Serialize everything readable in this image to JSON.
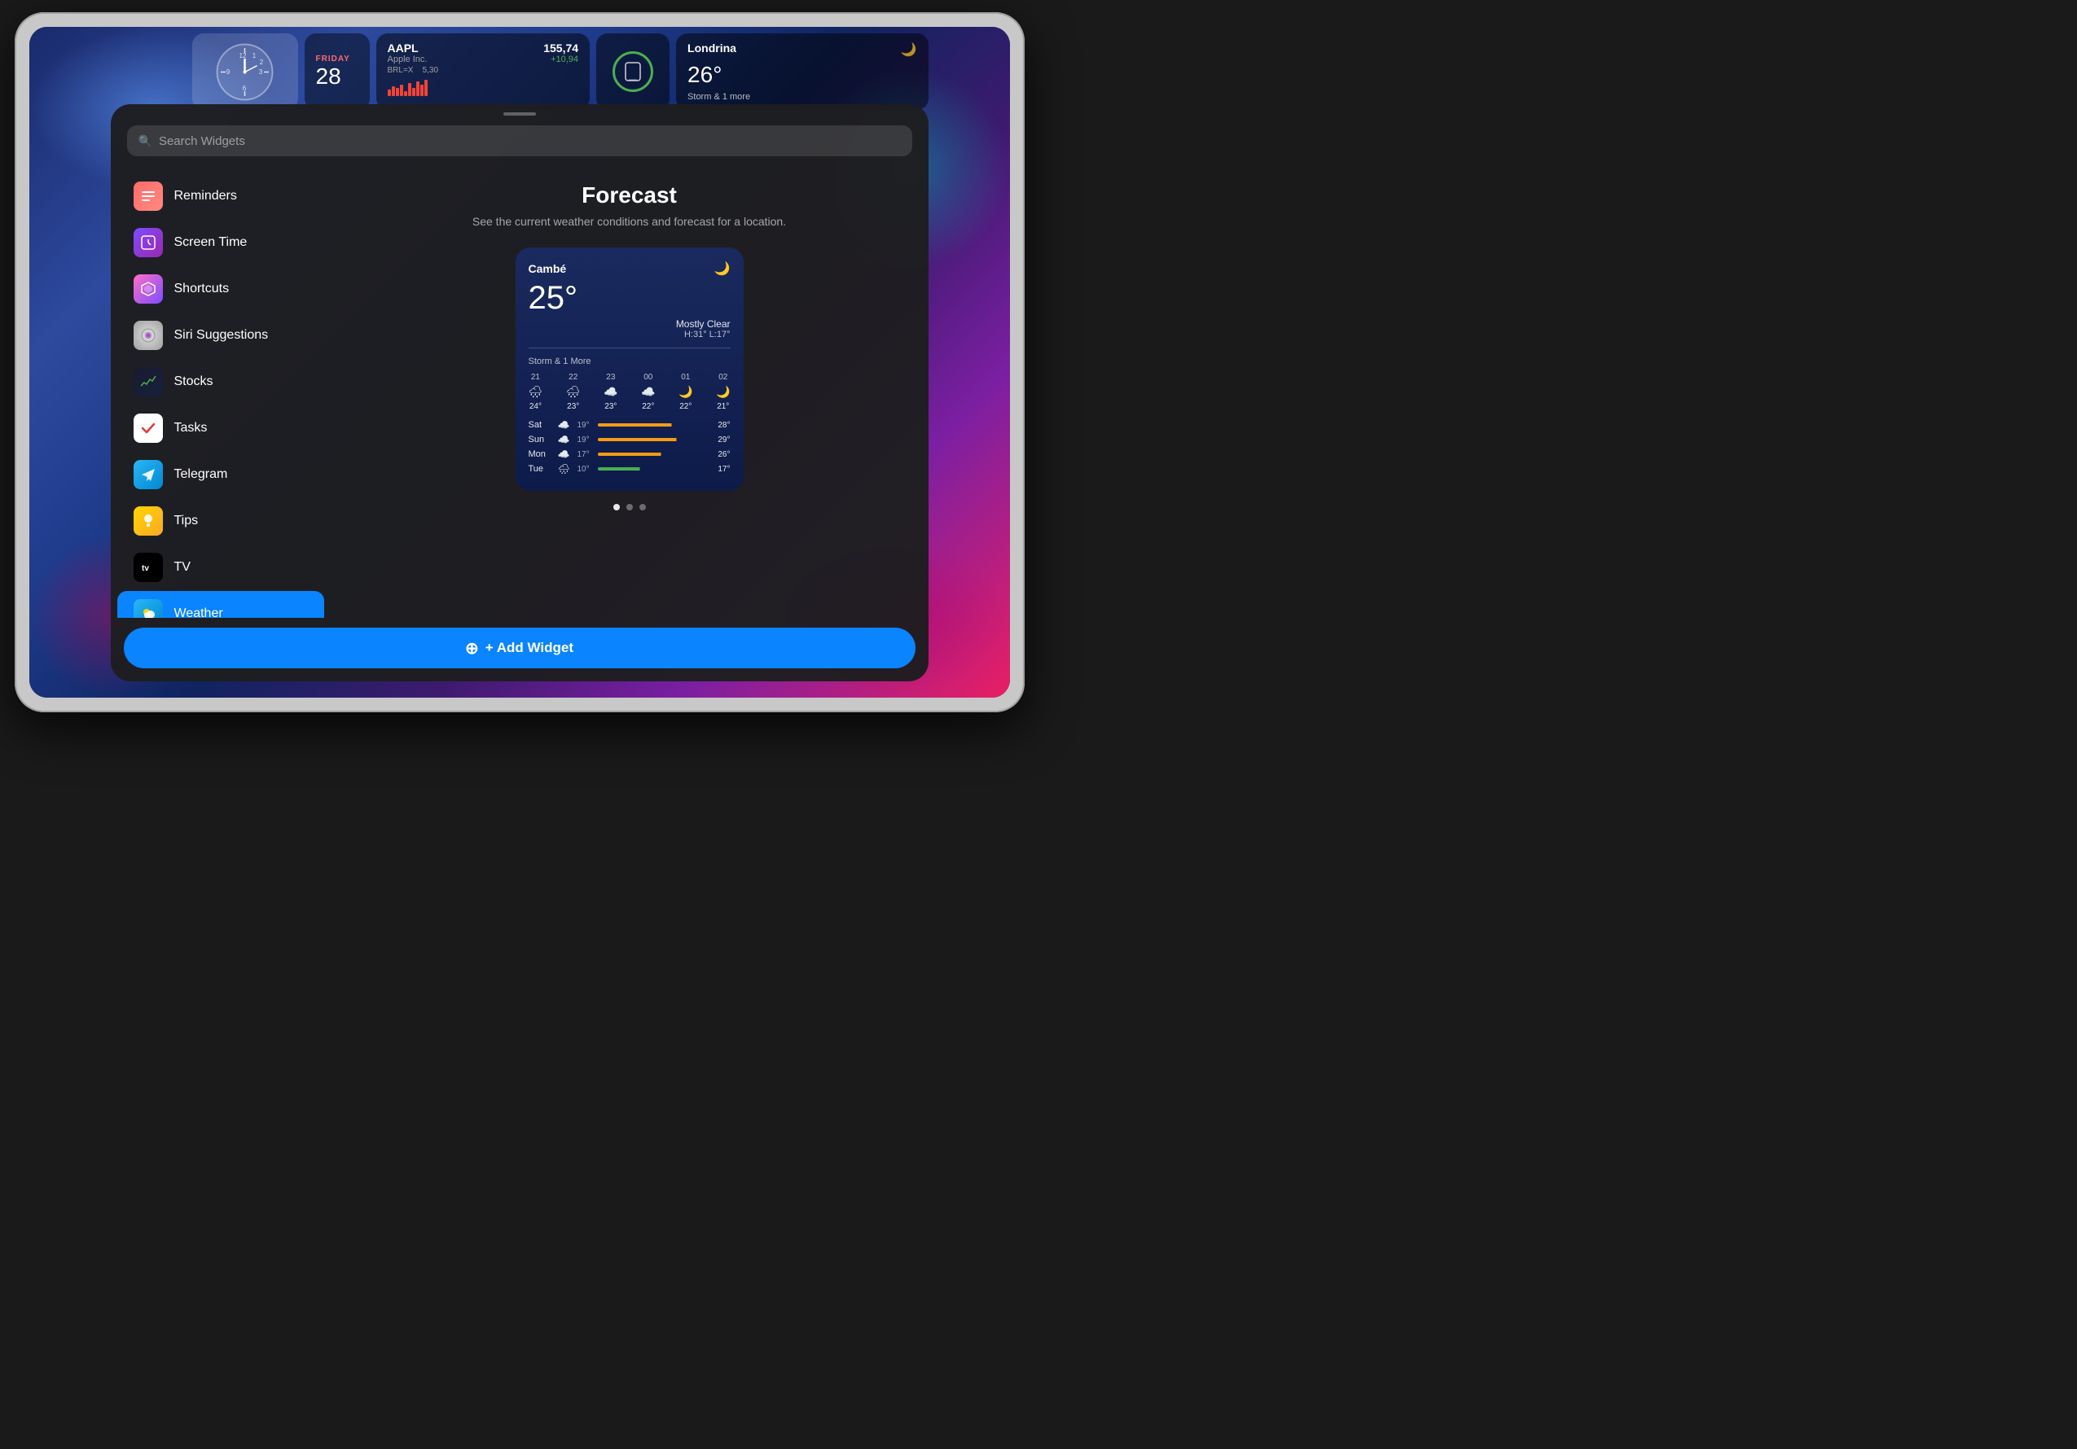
{
  "device": {
    "type": "iPad"
  },
  "wallpaper": {
    "style": "abstract colorful"
  },
  "widgets_bar": {
    "stock": {
      "ticker": "AAPL",
      "company": "Apple Inc.",
      "price": "155,74",
      "change": "+10,94",
      "brl_label": "BRL=X",
      "brl_value": "5,30"
    },
    "weather_top": {
      "city": "Londrina",
      "temp": "26°",
      "condition": "Storm & 1 more",
      "day_label": "FRIDAY",
      "day_number": "28"
    }
  },
  "panel": {
    "search": {
      "placeholder": "Search Widgets"
    },
    "sidebar": {
      "items": [
        {
          "id": "reminders",
          "name": "Reminders",
          "icon": "📋",
          "icon_class": "icon-reminders"
        },
        {
          "id": "screen-time",
          "name": "Screen Time",
          "icon": "⏱",
          "icon_class": "icon-screentime"
        },
        {
          "id": "shortcuts",
          "name": "Shortcuts",
          "icon": "❖",
          "icon_class": "icon-shortcuts"
        },
        {
          "id": "siri-suggestions",
          "name": "Siri Suggestions",
          "icon": "🔮",
          "icon_class": "icon-siri"
        },
        {
          "id": "stocks",
          "name": "Stocks",
          "icon": "📈",
          "icon_class": "icon-stocks"
        },
        {
          "id": "tasks",
          "name": "Tasks",
          "icon": "✓",
          "icon_class": "icon-tasks"
        },
        {
          "id": "telegram",
          "name": "Telegram",
          "icon": "✈",
          "icon_class": "icon-telegram"
        },
        {
          "id": "tips",
          "name": "Tips",
          "icon": "💡",
          "icon_class": "icon-tips"
        },
        {
          "id": "tv",
          "name": "TV",
          "icon": "📺",
          "icon_class": "icon-tv"
        },
        {
          "id": "weather",
          "name": "Weather",
          "icon": "⛅",
          "icon_class": "icon-weather",
          "active": true
        }
      ]
    },
    "content": {
      "title": "Forecast",
      "description": "See the current weather conditions and forecast for a location.",
      "weather_widget": {
        "location": "Cambé",
        "temp": "25°",
        "condition": "Mostly Clear",
        "high": "H:31°",
        "low": "L:17°",
        "storm_label": "Storm & 1 More",
        "hourly": [
          {
            "time": "21",
            "icon": "🌧",
            "temp": "24°"
          },
          {
            "time": "22",
            "icon": "🌧",
            "temp": "23°"
          },
          {
            "time": "23",
            "icon": "☁",
            "temp": "23°"
          },
          {
            "time": "00",
            "icon": "☁",
            "temp": "22°"
          },
          {
            "time": "01",
            "icon": "🌙",
            "temp": "22°"
          },
          {
            "time": "02",
            "icon": "🌙",
            "temp": "21°"
          }
        ],
        "daily": [
          {
            "day": "Sat",
            "icon": "☁",
            "low": "19°",
            "high": "28°",
            "bar_color": "#f39c12",
            "bar_width": "70%"
          },
          {
            "day": "Sun",
            "icon": "☁",
            "low": "19°",
            "high": "29°",
            "bar_color": "#f39c12",
            "bar_width": "75%"
          },
          {
            "day": "Mon",
            "icon": "☁",
            "low": "17°",
            "high": "26°",
            "bar_color": "#f39c12",
            "bar_width": "60%"
          },
          {
            "day": "Tue",
            "icon": "🌧",
            "low": "10°",
            "high": "17°",
            "bar_color": "#4caf50",
            "bar_width": "40%"
          }
        ]
      },
      "pagination": {
        "total": 3,
        "active": 0
      },
      "add_widget_button": "+ Add Widget"
    }
  }
}
